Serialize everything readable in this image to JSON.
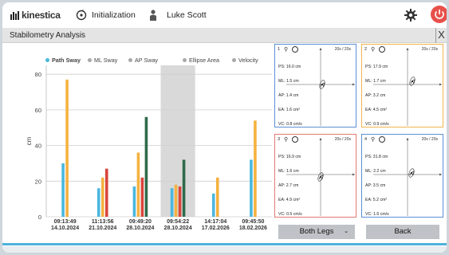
{
  "topbar": {
    "logo_text": "kinestica",
    "initialization_label": "Initialization",
    "user_name": "Luke Scott"
  },
  "titlebar": {
    "title": "Stabilometry Analysis",
    "close_label": "X"
  },
  "legend": [
    {
      "name": "Path Sway",
      "color": "#4ab7de",
      "bold": true
    },
    {
      "name": "ML Sway",
      "color": "#a8a8a8"
    },
    {
      "name": "AP Sway",
      "color": "#a8a8a8"
    },
    {
      "name": "Ellipse Area",
      "color": "#a8a8a8"
    },
    {
      "name": "Velocity",
      "color": "#a8a8a8"
    }
  ],
  "chart_data": {
    "type": "bar",
    "ylabel": "cm",
    "ylim": [
      0,
      85
    ],
    "yticks": [
      0,
      20,
      40,
      60,
      80
    ],
    "categories": [
      {
        "time": "09:13:49",
        "date": "14.10.2024"
      },
      {
        "time": "11:13:56",
        "date": "21.10.2024"
      },
      {
        "time": "09:49:20",
        "date": "28.10.2024"
      },
      {
        "time": "09:54:22",
        "date": "28.10.2024"
      },
      {
        "time": "14:17:04",
        "date": "17.02.2026"
      },
      {
        "time": "09:45:50",
        "date": "18.02.2026"
      }
    ],
    "highlighted_index": 3,
    "series": [
      {
        "color": "#4ab7de",
        "values": [
          30,
          16,
          17,
          16,
          13,
          32
        ]
      },
      {
        "color": "#f5b240",
        "values": [
          77,
          22,
          36,
          18,
          22,
          54
        ]
      },
      {
        "color": "#d9453b",
        "values": [
          0,
          27,
          22,
          17,
          0,
          0
        ]
      },
      {
        "color": "#2f6b4a",
        "values": [
          0,
          0,
          56,
          32,
          0,
          0
        ]
      }
    ]
  },
  "panels": [
    {
      "num": "1",
      "duration": "20s / 20s",
      "border": "#5b8fd6",
      "ps": "PS: 16.0 cm",
      "ml": "ML: 1.5 cm",
      "ap": "AP: 1.4 cm",
      "ea": "EA: 1.6 cm²",
      "vc": "VC: 0.8 cm/s"
    },
    {
      "num": "2",
      "duration": "20s / 20s",
      "border": "#f0b450",
      "ps": "PS: 17.9 cm",
      "ml": "ML: 1.7 cm",
      "ap": "AP: 3.2 cm",
      "ea": "EA: 4.5 cm²",
      "vc": "VC: 0.9 cm/s"
    },
    {
      "num": "3",
      "duration": "20s / 20s",
      "border": "#e07a70",
      "ps": "PS: 16.9 cm",
      "ml": "ML: 1.6 cm",
      "ap": "AP: 2.7 cm",
      "ea": "EA: 4.9 cm²",
      "vc": "VC: 0.5 cm/s"
    },
    {
      "num": "4",
      "duration": "20s / 20s",
      "border": "#5b8fd6",
      "ps": "PS: 31.8 cm",
      "ml": "ML: 2.2 cm",
      "ap": "AP: 3.5 cm",
      "ea": "EA: 5.2 cm²",
      "vc": "VC: 1.6 cm/s"
    }
  ],
  "controls": {
    "legs_select": "Both Legs",
    "back_label": "Back"
  }
}
